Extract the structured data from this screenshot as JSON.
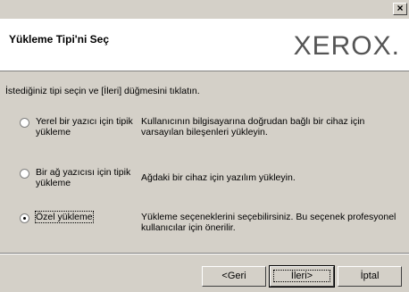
{
  "window": {
    "close_glyph": "×"
  },
  "header": {
    "title": "Yükleme Tipi'ni Seç",
    "logo": "XEROX."
  },
  "content": {
    "instruction": "İstediğiniz tipi seçin ve [İleri] düğmesini tıklatın.",
    "options": [
      {
        "label": "Yerel bir yazıcı için tipik yükleme",
        "description": "Kullanıcının bilgisayarına doğrudan bağlı bir cihaz için varsayılan bileşenleri yükleyin.",
        "selected": false
      },
      {
        "label": "Bir ağ yazıcısı için tipik yükleme",
        "description": "Ağdaki bir cihaz için yazılım yükleyin.",
        "selected": false
      },
      {
        "label": "Özel yükleme",
        "description": "Yükleme seçeneklerini seçebilirsiniz. Bu seçenek profesyonel kullanıcılar için önerilir.",
        "selected": true
      }
    ]
  },
  "buttons": {
    "back": "<Geri",
    "next": "İleri>",
    "cancel": "İptal"
  }
}
